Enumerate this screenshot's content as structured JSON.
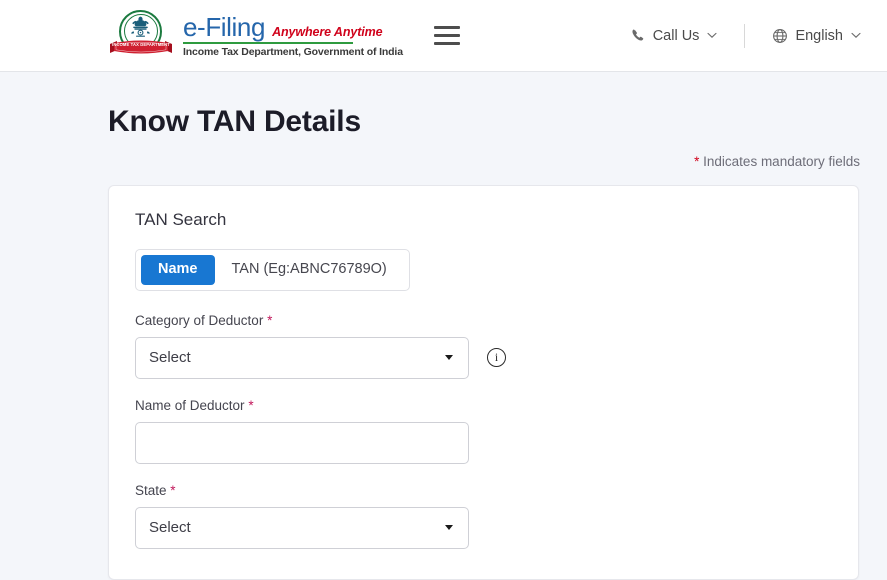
{
  "header": {
    "emblem": {
      "icon": "india-national-emblem-icon",
      "ribbon_text": "INCOME TAX DEPARTMENT"
    },
    "brand": {
      "name": "e-Filing",
      "tagline": "Anywhere Anytime",
      "subtitle": "Income Tax Department, Government of India"
    },
    "menu_icon": "hamburger-menu-icon",
    "call_us": {
      "icon": "phone-icon",
      "label": "Call Us",
      "chevron": "⌄"
    },
    "language": {
      "icon": "globe-icon",
      "label": "English",
      "chevron": "⌄"
    }
  },
  "page": {
    "title": "Know TAN Details",
    "mandatory_note": {
      "star": "*",
      "text": "Indicates mandatory fields"
    }
  },
  "card": {
    "title": "TAN Search",
    "search_mode": {
      "options": [
        {
          "label": "Name",
          "active": true
        },
        {
          "label": "TAN (Eg:ABNC76789O)",
          "active": false
        }
      ]
    },
    "fields": [
      {
        "label": "Category of Deductor",
        "required": "*",
        "type": "select",
        "value": "Select",
        "info_icon": "info-circle-icon"
      },
      {
        "label": "Name of Deductor",
        "required": "*",
        "type": "text",
        "value": "",
        "placeholder": ""
      },
      {
        "label": "State",
        "required": "*",
        "type": "select",
        "value": "Select"
      }
    ]
  },
  "colors": {
    "brand_blue": "#2566ab",
    "accent_blue": "#1877d2",
    "brand_red": "#d0021b",
    "brand_green": "#2e9b3f",
    "required_star": "#c2185b",
    "page_bg": "#f4f6fa"
  }
}
